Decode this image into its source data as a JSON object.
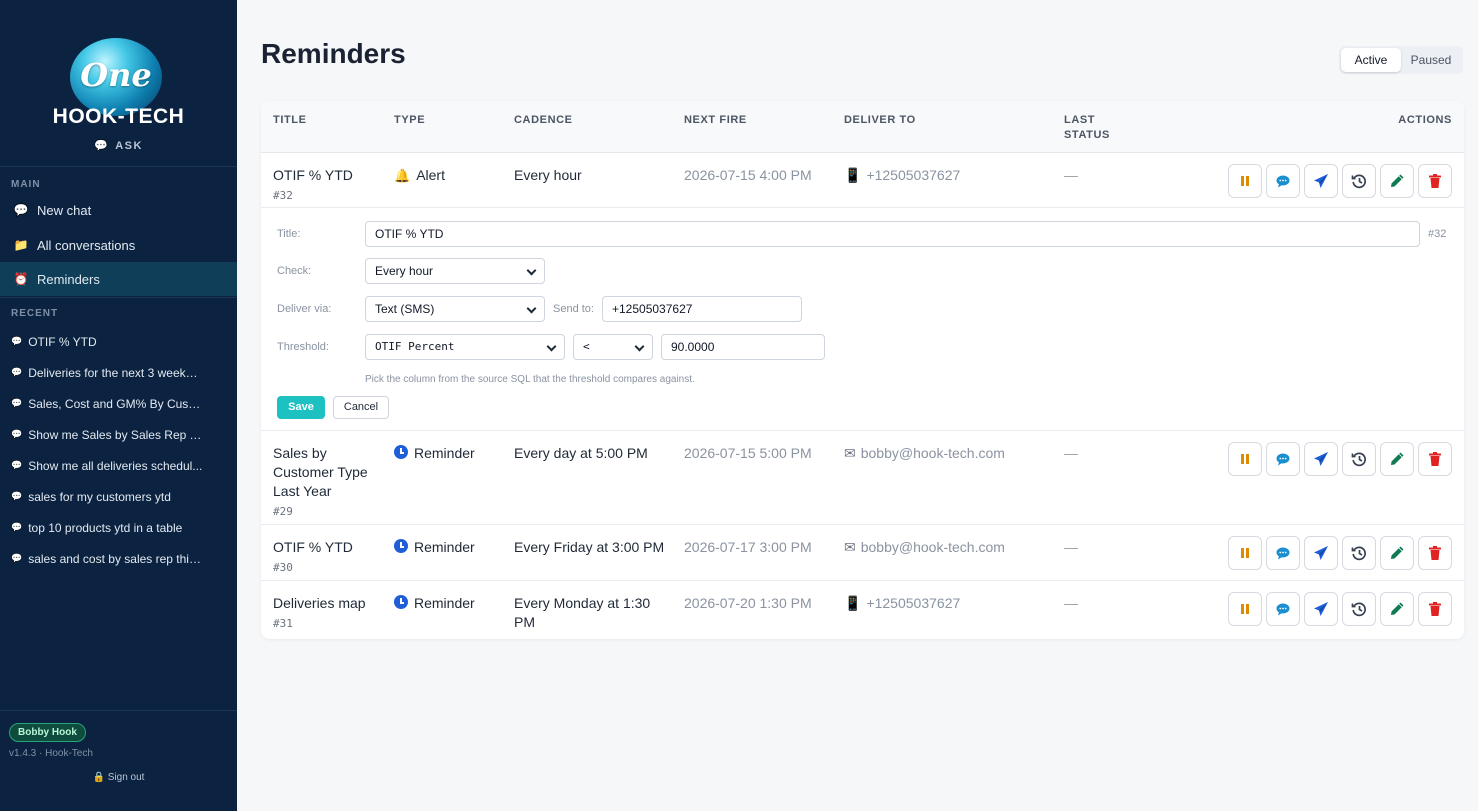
{
  "sidebar": {
    "logo_word": "One",
    "brand": "HOOK-TECH",
    "ask_label": "ASK",
    "main_heading": "MAIN",
    "nav": [
      {
        "icon": "speech-bubble-icon",
        "label": "New chat"
      },
      {
        "icon": "folder-icon",
        "label": "All conversations"
      },
      {
        "icon": "alarm-clock-icon",
        "label": "Reminders"
      }
    ],
    "active_nav": "Reminders",
    "recent_heading": "RECENT",
    "recent": [
      "OTIF % YTD",
      "Deliveries for the next 3 weeks ...",
      "Sales, Cost and GM% By Custo...",
      "Show me Sales by Sales Rep YT...",
      "Show me all deliveries schedul...",
      "sales for my customers ytd",
      "top 10 products ytd in a table",
      "sales and cost by sales rep this ..."
    ],
    "user_badge": "Bobby Hook",
    "version": "v1.4.3 · Hook-Tech",
    "sign_out": "Sign out"
  },
  "page": {
    "title": "Reminders",
    "tabs": [
      "Active",
      "Paused"
    ],
    "active_tab": "Active"
  },
  "table": {
    "headers": {
      "title": "TITLE",
      "type": "TYPE",
      "cadence": "CADENCE",
      "next_fire": "NEXT FIRE",
      "deliver_to": "DELIVER TO",
      "last_status_1": "LAST",
      "last_status_2": "STATUS",
      "actions": "ACTIONS"
    },
    "rows": [
      {
        "title": "OTIF % YTD",
        "id": "#32",
        "type": "Alert",
        "type_icon": "bell-icon",
        "cadence": "Every hour",
        "next_fire": "2026-07-15 4:00 PM",
        "deliver_icon": "phone-icon",
        "deliver_to": "+12505037627",
        "last_status": "—"
      },
      {
        "title": "Sales by Customer Type Last Year",
        "id": "#29",
        "type": "Reminder",
        "type_icon": "clock-icon",
        "cadence": "Every day at 5:00 PM",
        "next_fire": "2026-07-15 5:00 PM",
        "deliver_icon": "envelope-icon",
        "deliver_to": "bobby@hook-tech.com",
        "last_status": "—"
      },
      {
        "title": "OTIF % YTD",
        "id": "#30",
        "type": "Reminder",
        "type_icon": "clock-icon",
        "cadence": "Every Friday at 3:00 PM",
        "next_fire": "2026-07-17 3:00 PM",
        "deliver_icon": "envelope-icon",
        "deliver_to": "bobby@hook-tech.com",
        "last_status": "—"
      },
      {
        "title": "Deliveries map",
        "id": "#31",
        "type": "Reminder",
        "type_icon": "clock-icon",
        "cadence": "Every Monday at 1:30 PM",
        "next_fire": "2026-07-20 1:30 PM",
        "deliver_icon": "phone-icon",
        "deliver_to": "+12505037627",
        "last_status": "—"
      }
    ],
    "action_icons": [
      "pause-icon",
      "chat-icon",
      "send-icon",
      "history-icon",
      "edit-pencil-icon",
      "trash-icon"
    ]
  },
  "editor": {
    "title_label": "Title:",
    "title_value": "OTIF % YTD",
    "id_tag": "#32",
    "check_label": "Check:",
    "check_value": "Every hour",
    "deliver_label": "Deliver via:",
    "deliver_value": "Text (SMS)",
    "send_to_label": "Send to:",
    "send_to_value": "+12505037627",
    "threshold_label": "Threshold:",
    "threshold_column": "OTIF Percent",
    "threshold_operator": "<",
    "threshold_value": "90.0000",
    "hint": "Pick the column from the source SQL that the threshold compares against.",
    "save": "Save",
    "cancel": "Cancel"
  },
  "colors": {
    "sidebar_bg": "#0b2340",
    "active_nav_bg": "#0e3e58",
    "save_button": "#1ec1c1",
    "alert_red": "#e02424",
    "reminder_blue": "#1e5fd8",
    "pause_orange": "#e08a00"
  }
}
